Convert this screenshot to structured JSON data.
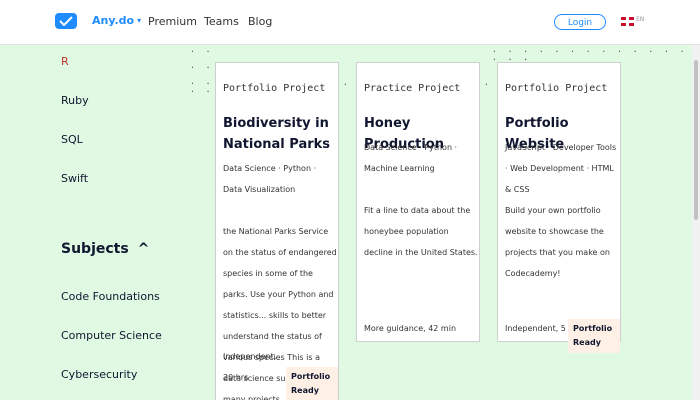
{
  "nav": {
    "brand": "Any.do",
    "brand_chevron": "▾",
    "links": [
      "Premium",
      "Teams",
      "Blog"
    ],
    "login_label": "Login",
    "lang_code": "EN"
  },
  "sidebar": {
    "languages": [
      "R",
      "Ruby",
      "SQL",
      "Swift"
    ],
    "subjects_heading": "Subjects",
    "subjects_chevron": "^",
    "subjects": [
      "Code Foundations",
      "Computer Science",
      "Cybersecurity"
    ]
  },
  "cards": [
    {
      "type": "Portfolio Project",
      "title": "Biodiversity in National Parks",
      "tags": "Data Science · Python · Data Visualization",
      "description": "the National Parks Service on the status of endangered species in some of the parks. Use your Python and statistics... skills to better understand the status of various species This is a data science subject with many projects",
      "meta": "Independent, 20 hrs",
      "badge": "Portfolio Ready"
    },
    {
      "type": "Practice Project",
      "title": "Honey Production",
      "tags": "Data Science · Python · Machine Learning",
      "description": "Fit a line to data about the honeybee population decline in the United States.",
      "meta": "More guidance, 42 min",
      "badge": ""
    },
    {
      "type": "Portfolio Project",
      "title": "Portfolio Website",
      "tags": "JavaScript · Developer Tools · Web Development · HTML & CSS",
      "description": "Build your own portfolio website to showcase the projects that you make on Codecademy!",
      "meta": "Independent, 5 hrs",
      "badge": "Portfolio Ready"
    }
  ],
  "colors": {
    "accent": "#1e8cff",
    "page_background": "#dff9e3",
    "badge_background": "#fff0e5"
  },
  "icons": [
    "check-icon",
    "chevron-down-icon",
    "flag-icon",
    "chevron-up-icon"
  ]
}
